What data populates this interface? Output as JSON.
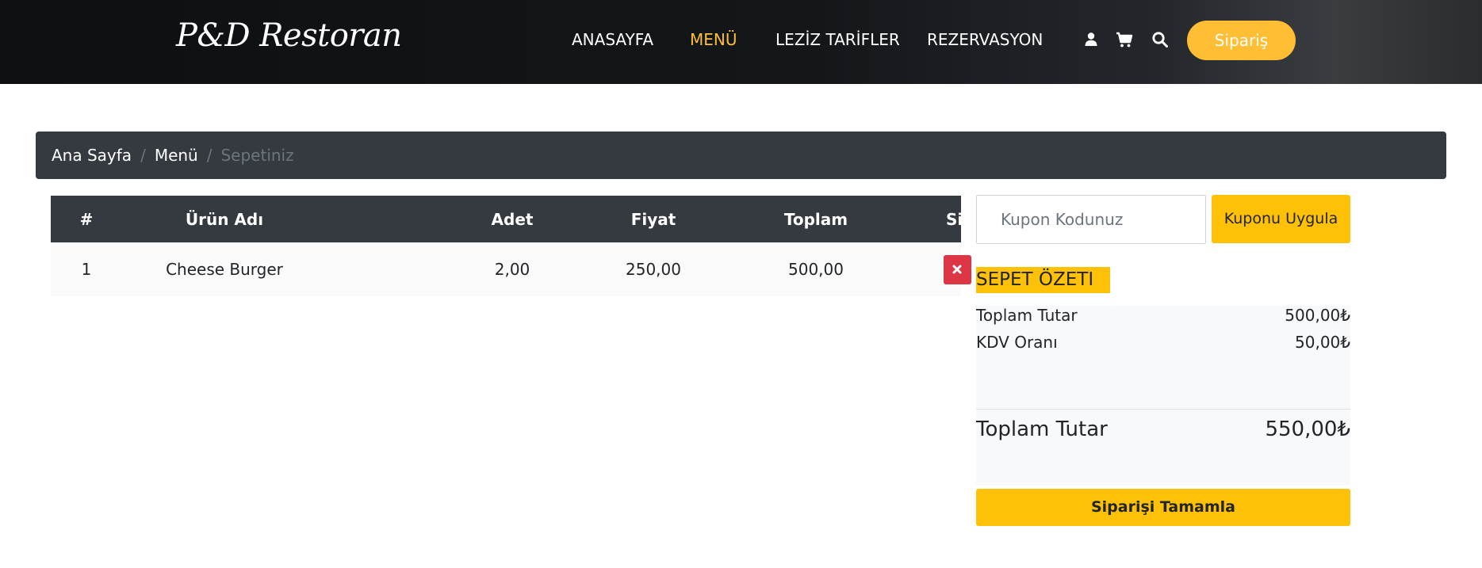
{
  "header": {
    "logo": "P&D Restoran",
    "nav": [
      {
        "label": "ANASAYFA"
      },
      {
        "label": "MENÜ",
        "active": true
      },
      {
        "label": "LEZİZ TARİFLER"
      },
      {
        "label": "REZERVASYON"
      }
    ],
    "icons": [
      "user-icon",
      "cart-icon",
      "search-icon"
    ],
    "order_button": "Sipariş"
  },
  "breadcrumb": {
    "items": [
      "Ana Sayfa",
      "Menü"
    ],
    "separator": "/",
    "current": "Sepetiniz"
  },
  "cart": {
    "columns": [
      "#",
      "Ürün Adı",
      "Adet",
      "Fiyat",
      "Toplam",
      "Sil"
    ],
    "rows": [
      {
        "index": "1",
        "name": "Cheese Burger",
        "qty": "2,00",
        "price": "250,00",
        "total": "500,00"
      }
    ],
    "delete_icon": "close-icon"
  },
  "coupon": {
    "placeholder": "Kupon Kodunuz",
    "value": "",
    "apply_label": "Kuponu Uygula"
  },
  "summary": {
    "title": "SEPET ÖZETI",
    "subtotal_label": "Toplam Tutar",
    "subtotal_value": "500,00₺",
    "tax_label": "KDV Oranı",
    "tax_value": "50,00₺",
    "total_label": "Toplam Tutar",
    "total_value": "550,00₺",
    "complete_label": "Siparişi Tamamla"
  },
  "colors": {
    "accent": "#ffbe33",
    "button_yellow": "#ffc107",
    "dark": "#343a40",
    "danger": "#dc3545"
  }
}
